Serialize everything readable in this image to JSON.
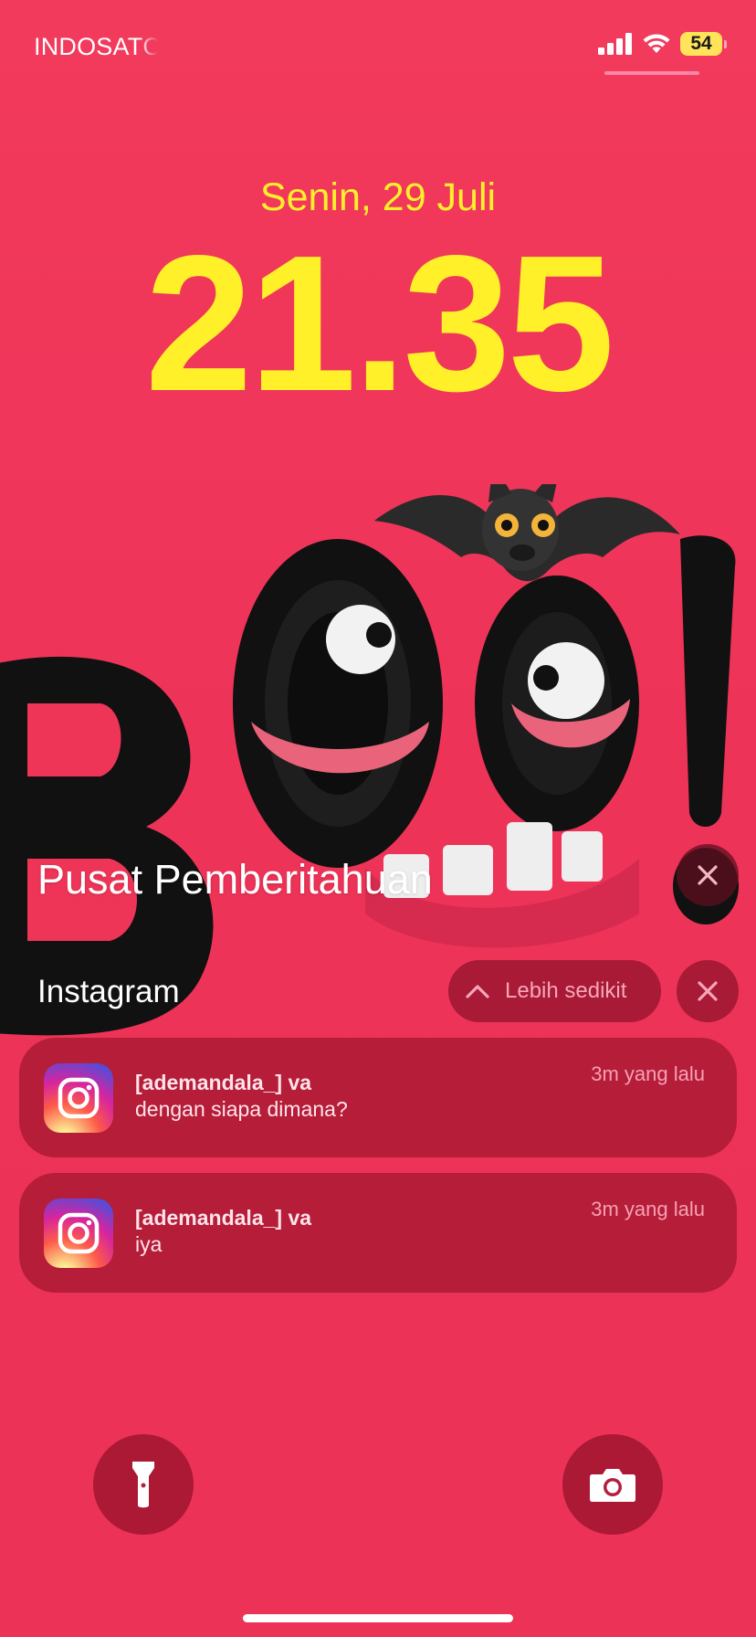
{
  "status_bar": {
    "carrier": "INDOSATC",
    "battery_level": "54",
    "icons": [
      "signal-icon",
      "wifi-icon",
      "battery-icon"
    ]
  },
  "lock_screen": {
    "date": "Senin, 29 Juli",
    "time": "21.35"
  },
  "notification_center": {
    "title": "Pusat Pemberitahuan",
    "group": {
      "app_name": "Instagram",
      "show_less_label": "Lebih sedikit"
    },
    "notifications": [
      {
        "sender": "[ademandala_] va",
        "message": "dengan siapa dimana?",
        "time": "3m yang lalu",
        "icon": "instagram-icon"
      },
      {
        "sender": "[ademandala_] va",
        "message": "iya",
        "time": "3m yang lalu",
        "icon": "instagram-icon"
      }
    ]
  },
  "bottom_controls": {
    "left": "flashlight-icon",
    "right": "camera-icon"
  },
  "colors": {
    "background": "#ee3558",
    "date_time": "#fff02a",
    "notification_bg": "#b51d38",
    "battery": "#ffe45a"
  }
}
